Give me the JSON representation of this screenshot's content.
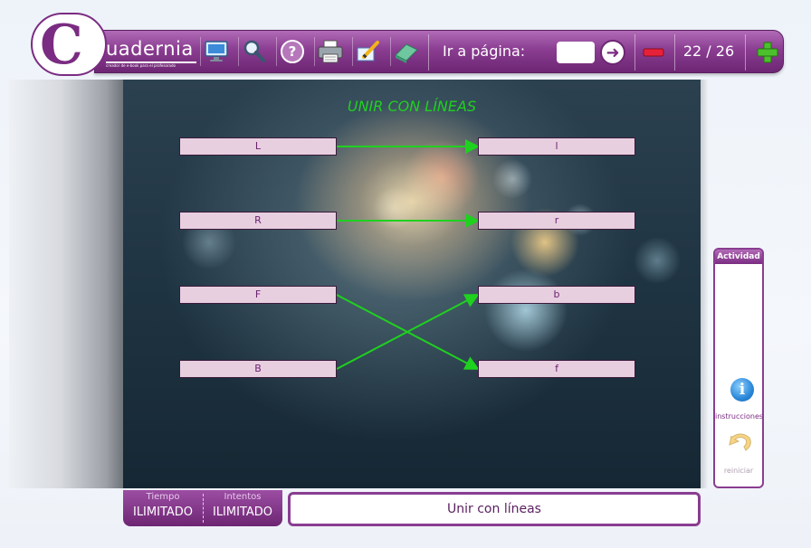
{
  "app": {
    "brand_text": "uadernia",
    "brand_tagline": "creador de e-book para el profesorado"
  },
  "toolbar": {
    "icons": [
      "monitor-icon",
      "search-icon",
      "help-icon",
      "print-icon",
      "edit-icon",
      "eraser-icon"
    ],
    "goto_label": "Ir a página:",
    "goto_value": "",
    "page_counter": "22 / 26"
  },
  "activity_title": "UNIR CON LÍNEAS",
  "left_items": [
    "L",
    "R",
    "F",
    "B"
  ],
  "right_items": [
    "l",
    "r",
    "b",
    "f"
  ],
  "connections": [
    [
      0,
      0
    ],
    [
      1,
      1
    ],
    [
      2,
      3
    ],
    [
      3,
      2
    ]
  ],
  "colors": {
    "accent": "#7a2c82",
    "line": "#1fd11f",
    "box_fill": "#e8cfe0"
  },
  "side_panel": {
    "title": "Actividad",
    "instructions_label": "instrucciones",
    "reset_label": "reiniciar"
  },
  "stats": {
    "time_label": "Tiempo",
    "time_value": "ILIMITADO",
    "attempts_label": "Intentos",
    "attempts_value": "ILIMITADO"
  },
  "caption": "Unir con líneas"
}
